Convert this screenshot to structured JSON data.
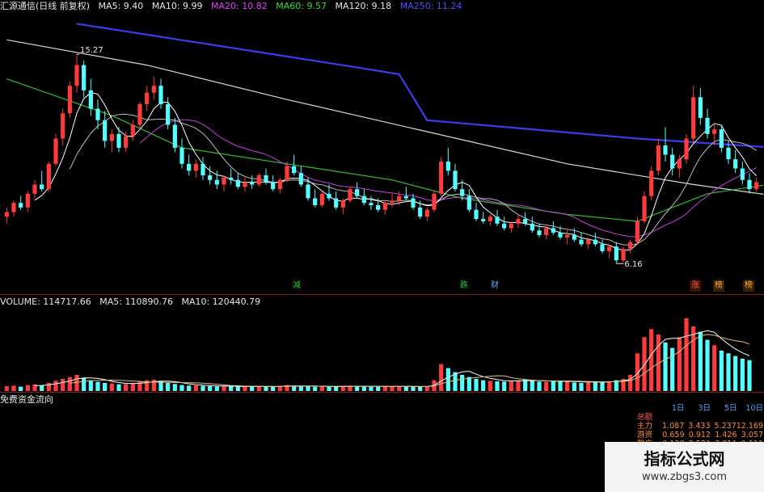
{
  "header": {
    "stock_name": "汇源通信(日线 前复权)",
    "indicators": [
      {
        "label": "MA5: 9.40",
        "color": "#e6e6e6"
      },
      {
        "label": "MA10: 9.99",
        "color": "#e6e6e6"
      },
      {
        "label": "MA20: 10.82",
        "color": "#e040ff"
      },
      {
        "label": "MA60: 9.57",
        "color": "#33dd33"
      },
      {
        "label": "MA120: 9.18",
        "color": "#e6e6e6"
      },
      {
        "label": "MA250: 11.24",
        "color": "#5050ff"
      }
    ]
  },
  "volume_header": {
    "label": "VOLUME: 114717.66",
    "ma5": "MA5: 110890.76",
    "ma10": "MA10: 120440.79"
  },
  "flow_header": {
    "label": "免费资金流向"
  },
  "annotations": {
    "high": "15.27",
    "low": "6.16",
    "badges": [
      {
        "text": "减",
        "color": "#33cc33"
      },
      {
        "text": "跌",
        "color": "#33cc33"
      },
      {
        "text": "财",
        "color": "#66aaff"
      },
      {
        "text": "涨",
        "color": "#ff5555"
      },
      {
        "text": "榜",
        "color": "#ffaa33"
      },
      {
        "text": "榜",
        "color": "#ffaa33"
      }
    ]
  },
  "flow_table": {
    "columns": [
      "1日",
      "3日",
      "5日",
      "10日"
    ],
    "rows": [
      {
        "label": "总额",
        "values": [
          "",
          "",
          "",
          ""
        ]
      },
      {
        "label": "主力",
        "values": [
          "1.087",
          "3.433",
          "5.237",
          "12.169"
        ]
      },
      {
        "label": "游资",
        "values": [
          "0.659",
          "0.912",
          "1.426",
          "3.057"
        ]
      },
      {
        "label": "散户",
        "values": [
          "0.128",
          "2.521",
          "3.811",
          "9.111"
        ]
      }
    ]
  },
  "watermark": {
    "title": "指标公式网",
    "url": "www.zbgs3.com"
  },
  "colors": {
    "up": "#ff3c3c",
    "down": "#54ffff",
    "separator": "#8a1c1c"
  },
  "chart_data": [
    {
      "type": "candlestick",
      "title": "汇源通信(日线 前复权)",
      "ohlc": [
        [
          8.2,
          8.6,
          7.9,
          8.4
        ],
        [
          8.4,
          8.9,
          8.2,
          8.8
        ],
        [
          8.8,
          9.1,
          8.5,
          8.6
        ],
        [
          8.6,
          9.3,
          8.4,
          9.2
        ],
        [
          9.2,
          9.8,
          9.0,
          9.6
        ],
        [
          9.6,
          10.2,
          9.3,
          9.4
        ],
        [
          9.4,
          10.6,
          9.3,
          10.5
        ],
        [
          10.5,
          11.8,
          10.4,
          11.6
        ],
        [
          11.6,
          12.9,
          11.3,
          12.7
        ],
        [
          12.7,
          14.1,
          12.5,
          13.9
        ],
        [
          13.9,
          15.27,
          13.6,
          14.8
        ],
        [
          14.8,
          15.0,
          13.4,
          13.7
        ],
        [
          13.7,
          14.2,
          12.6,
          12.9
        ],
        [
          12.9,
          13.3,
          12.0,
          12.4
        ],
        [
          12.4,
          12.8,
          11.2,
          11.5
        ],
        [
          11.5,
          12.0,
          11.0,
          11.8
        ],
        [
          11.8,
          12.1,
          11.0,
          11.2
        ],
        [
          11.2,
          11.9,
          11.0,
          11.7
        ],
        [
          11.7,
          12.4,
          11.5,
          12.2
        ],
        [
          12.2,
          13.2,
          12.0,
          13.1
        ],
        [
          13.1,
          13.9,
          12.8,
          13.6
        ],
        [
          13.6,
          14.3,
          13.3,
          13.9
        ],
        [
          13.9,
          14.2,
          12.9,
          13.1
        ],
        [
          13.1,
          13.4,
          12.0,
          12.2
        ],
        [
          12.2,
          12.5,
          11.0,
          11.2
        ],
        [
          11.2,
          11.6,
          10.3,
          10.5
        ],
        [
          10.5,
          10.9,
          10.0,
          10.2
        ],
        [
          10.2,
          10.7,
          9.9,
          10.5
        ],
        [
          10.5,
          10.8,
          9.8,
          10.0
        ],
        [
          10.0,
          10.4,
          9.6,
          9.8
        ],
        [
          9.8,
          10.2,
          9.4,
          9.6
        ],
        [
          9.6,
          10.0,
          9.3,
          9.9
        ],
        [
          9.9,
          10.3,
          9.6,
          9.8
        ],
        [
          9.8,
          10.1,
          9.4,
          9.5
        ],
        [
          9.5,
          9.9,
          9.3,
          9.7
        ],
        [
          9.7,
          10.0,
          9.4,
          9.6
        ],
        [
          9.6,
          10.1,
          9.5,
          10.0
        ],
        [
          10.0,
          10.3,
          9.6,
          9.7
        ],
        [
          9.7,
          10.0,
          9.3,
          9.4
        ],
        [
          9.4,
          9.9,
          9.2,
          9.8
        ],
        [
          9.8,
          10.6,
          9.7,
          10.4
        ],
        [
          10.4,
          10.9,
          10.0,
          10.1
        ],
        [
          10.1,
          10.4,
          9.5,
          9.6
        ],
        [
          9.6,
          9.9,
          8.9,
          9.0
        ],
        [
          9.0,
          9.4,
          8.6,
          8.7
        ],
        [
          8.7,
          9.3,
          8.6,
          9.2
        ],
        [
          9.2,
          9.6,
          8.9,
          9.0
        ],
        [
          9.0,
          9.3,
          8.5,
          8.6
        ],
        [
          8.6,
          9.0,
          8.3,
          8.9
        ],
        [
          8.9,
          9.5,
          8.8,
          9.4
        ],
        [
          9.4,
          9.7,
          9.0,
          9.1
        ],
        [
          9.1,
          9.4,
          8.7,
          8.8
        ],
        [
          8.8,
          9.1,
          8.5,
          8.7
        ],
        [
          8.7,
          9.0,
          8.4,
          8.5
        ],
        [
          8.5,
          8.9,
          8.3,
          8.8
        ],
        [
          8.8,
          9.2,
          8.6,
          8.9
        ],
        [
          8.9,
          9.3,
          8.7,
          9.1
        ],
        [
          9.1,
          9.5,
          8.9,
          9.0
        ],
        [
          9.0,
          9.2,
          8.5,
          8.6
        ],
        [
          8.6,
          8.9,
          8.1,
          8.2
        ],
        [
          8.2,
          8.6,
          8.0,
          8.5
        ],
        [
          8.5,
          9.3,
          8.4,
          9.2
        ],
        [
          9.2,
          10.8,
          9.1,
          10.6
        ],
        [
          10.6,
          11.2,
          10.0,
          10.2
        ],
        [
          10.2,
          10.5,
          9.3,
          9.4
        ],
        [
          9.4,
          9.8,
          8.9,
          9.1
        ],
        [
          9.1,
          9.4,
          8.4,
          8.5
        ],
        [
          8.5,
          8.8,
          8.0,
          8.1
        ],
        [
          8.1,
          8.4,
          7.9,
          8.0
        ],
        [
          8.0,
          8.3,
          7.8,
          8.2
        ],
        [
          8.2,
          8.5,
          7.8,
          7.9
        ],
        [
          7.9,
          8.2,
          7.6,
          7.7
        ],
        [
          7.7,
          8.0,
          7.5,
          7.9
        ],
        [
          7.9,
          8.3,
          7.7,
          8.1
        ],
        [
          8.1,
          8.4,
          7.8,
          7.9
        ],
        [
          7.9,
          8.2,
          7.5,
          7.6
        ],
        [
          7.6,
          7.9,
          7.3,
          7.4
        ],
        [
          7.4,
          7.8,
          7.2,
          7.7
        ],
        [
          7.7,
          8.0,
          7.4,
          7.5
        ],
        [
          7.5,
          7.8,
          7.2,
          7.3
        ],
        [
          7.3,
          7.6,
          7.0,
          7.4
        ],
        [
          7.4,
          7.7,
          7.1,
          7.2
        ],
        [
          7.2,
          7.5,
          6.9,
          7.0
        ],
        [
          7.0,
          7.3,
          6.8,
          7.2
        ],
        [
          7.2,
          7.5,
          6.9,
          7.0
        ],
        [
          7.0,
          7.2,
          6.6,
          6.7
        ],
        [
          6.7,
          7.0,
          6.4,
          6.9
        ],
        [
          6.9,
          7.1,
          6.16,
          6.3
        ],
        [
          6.3,
          6.9,
          6.2,
          6.8
        ],
        [
          6.8,
          7.2,
          6.6,
          7.1
        ],
        [
          7.1,
          8.2,
          7.0,
          8.0
        ],
        [
          8.0,
          9.3,
          7.9,
          9.1
        ],
        [
          9.1,
          10.4,
          8.9,
          10.2
        ],
        [
          10.2,
          11.6,
          10.0,
          11.3
        ],
        [
          11.3,
          12.1,
          10.6,
          10.9
        ],
        [
          10.9,
          11.2,
          10.0,
          10.3
        ],
        [
          10.3,
          10.9,
          9.9,
          10.7
        ],
        [
          10.7,
          11.8,
          10.5,
          11.6
        ],
        [
          11.6,
          13.9,
          11.4,
          13.4
        ],
        [
          13.4,
          13.8,
          12.2,
          12.5
        ],
        [
          12.5,
          12.9,
          11.6,
          11.8
        ],
        [
          11.8,
          12.3,
          11.3,
          12.0
        ],
        [
          12.0,
          12.2,
          11.0,
          11.2
        ],
        [
          11.2,
          11.5,
          10.5,
          10.7
        ],
        [
          10.7,
          11.1,
          10.1,
          10.3
        ],
        [
          10.3,
          10.6,
          9.6,
          9.8
        ],
        [
          9.8,
          10.1,
          9.2,
          9.4
        ],
        [
          9.4,
          9.9,
          9.3,
          9.7
        ]
      ],
      "moving_averages": [
        {
          "name": "MA5",
          "value": 9.4,
          "color": "#e6e6e6"
        },
        {
          "name": "MA10",
          "value": 9.99,
          "color": "#e6e6e6"
        },
        {
          "name": "MA20",
          "value": 10.82,
          "color": "#e040ff"
        },
        {
          "name": "MA60",
          "value": 9.57,
          "color": "#33dd33"
        },
        {
          "name": "MA120",
          "value": 9.18,
          "color": "#e6e6e6"
        },
        {
          "name": "MA250",
          "value": 11.24,
          "color": "#5050ff"
        }
      ],
      "ma120_points": [
        [
          0,
          15.9
        ],
        [
          20,
          14.8
        ],
        [
          40,
          13.3
        ],
        [
          60,
          11.9
        ],
        [
          80,
          10.5
        ],
        [
          98,
          9.6
        ],
        [
          108,
          9.18
        ]
      ],
      "ma250_points": [
        [
          10,
          16.6
        ],
        [
          50,
          14.7
        ],
        [
          56,
          14.4
        ],
        [
          60,
          12.4
        ],
        [
          90,
          11.6
        ],
        [
          108,
          11.24
        ]
      ],
      "ma60_points": [
        [
          0,
          14.2
        ],
        [
          15,
          12.6
        ],
        [
          25,
          11.2
        ],
        [
          40,
          10.5
        ],
        [
          55,
          9.8
        ],
        [
          65,
          9.0
        ],
        [
          80,
          8.3
        ],
        [
          90,
          8.0
        ],
        [
          100,
          9.2
        ],
        [
          108,
          9.57
        ]
      ],
      "ylim": [
        5.5,
        17.0
      ],
      "annotations": [
        {
          "text": "15.27",
          "index": 10,
          "value": 15.27
        },
        {
          "text": "6.16",
          "index": 87,
          "value": 6.16
        }
      ]
    },
    {
      "type": "bar",
      "title": "VOLUME",
      "values": [
        18,
        20,
        16,
        22,
        25,
        20,
        30,
        38,
        45,
        52,
        60,
        48,
        40,
        34,
        30,
        28,
        25,
        26,
        30,
        35,
        40,
        42,
        36,
        30,
        26,
        22,
        20,
        21,
        19,
        18,
        17,
        18,
        17,
        16,
        16,
        17,
        18,
        17,
        16,
        18,
        22,
        20,
        18,
        17,
        16,
        17,
        16,
        16,
        17,
        20,
        19,
        17,
        16,
        16,
        17,
        18,
        18,
        17,
        16,
        15,
        17,
        40,
        100,
        85,
        70,
        60,
        52,
        45,
        40,
        38,
        36,
        35,
        38,
        40,
        42,
        38,
        35,
        34,
        36,
        38,
        35,
        32,
        30,
        34,
        36,
        33,
        36,
        40,
        45,
        60,
        140,
        200,
        230,
        210,
        180,
        160,
        200,
        270,
        240,
        220,
        190,
        170,
        150,
        140,
        130,
        120,
        114.7
      ],
      "ylim": [
        0,
        300
      ]
    }
  ]
}
